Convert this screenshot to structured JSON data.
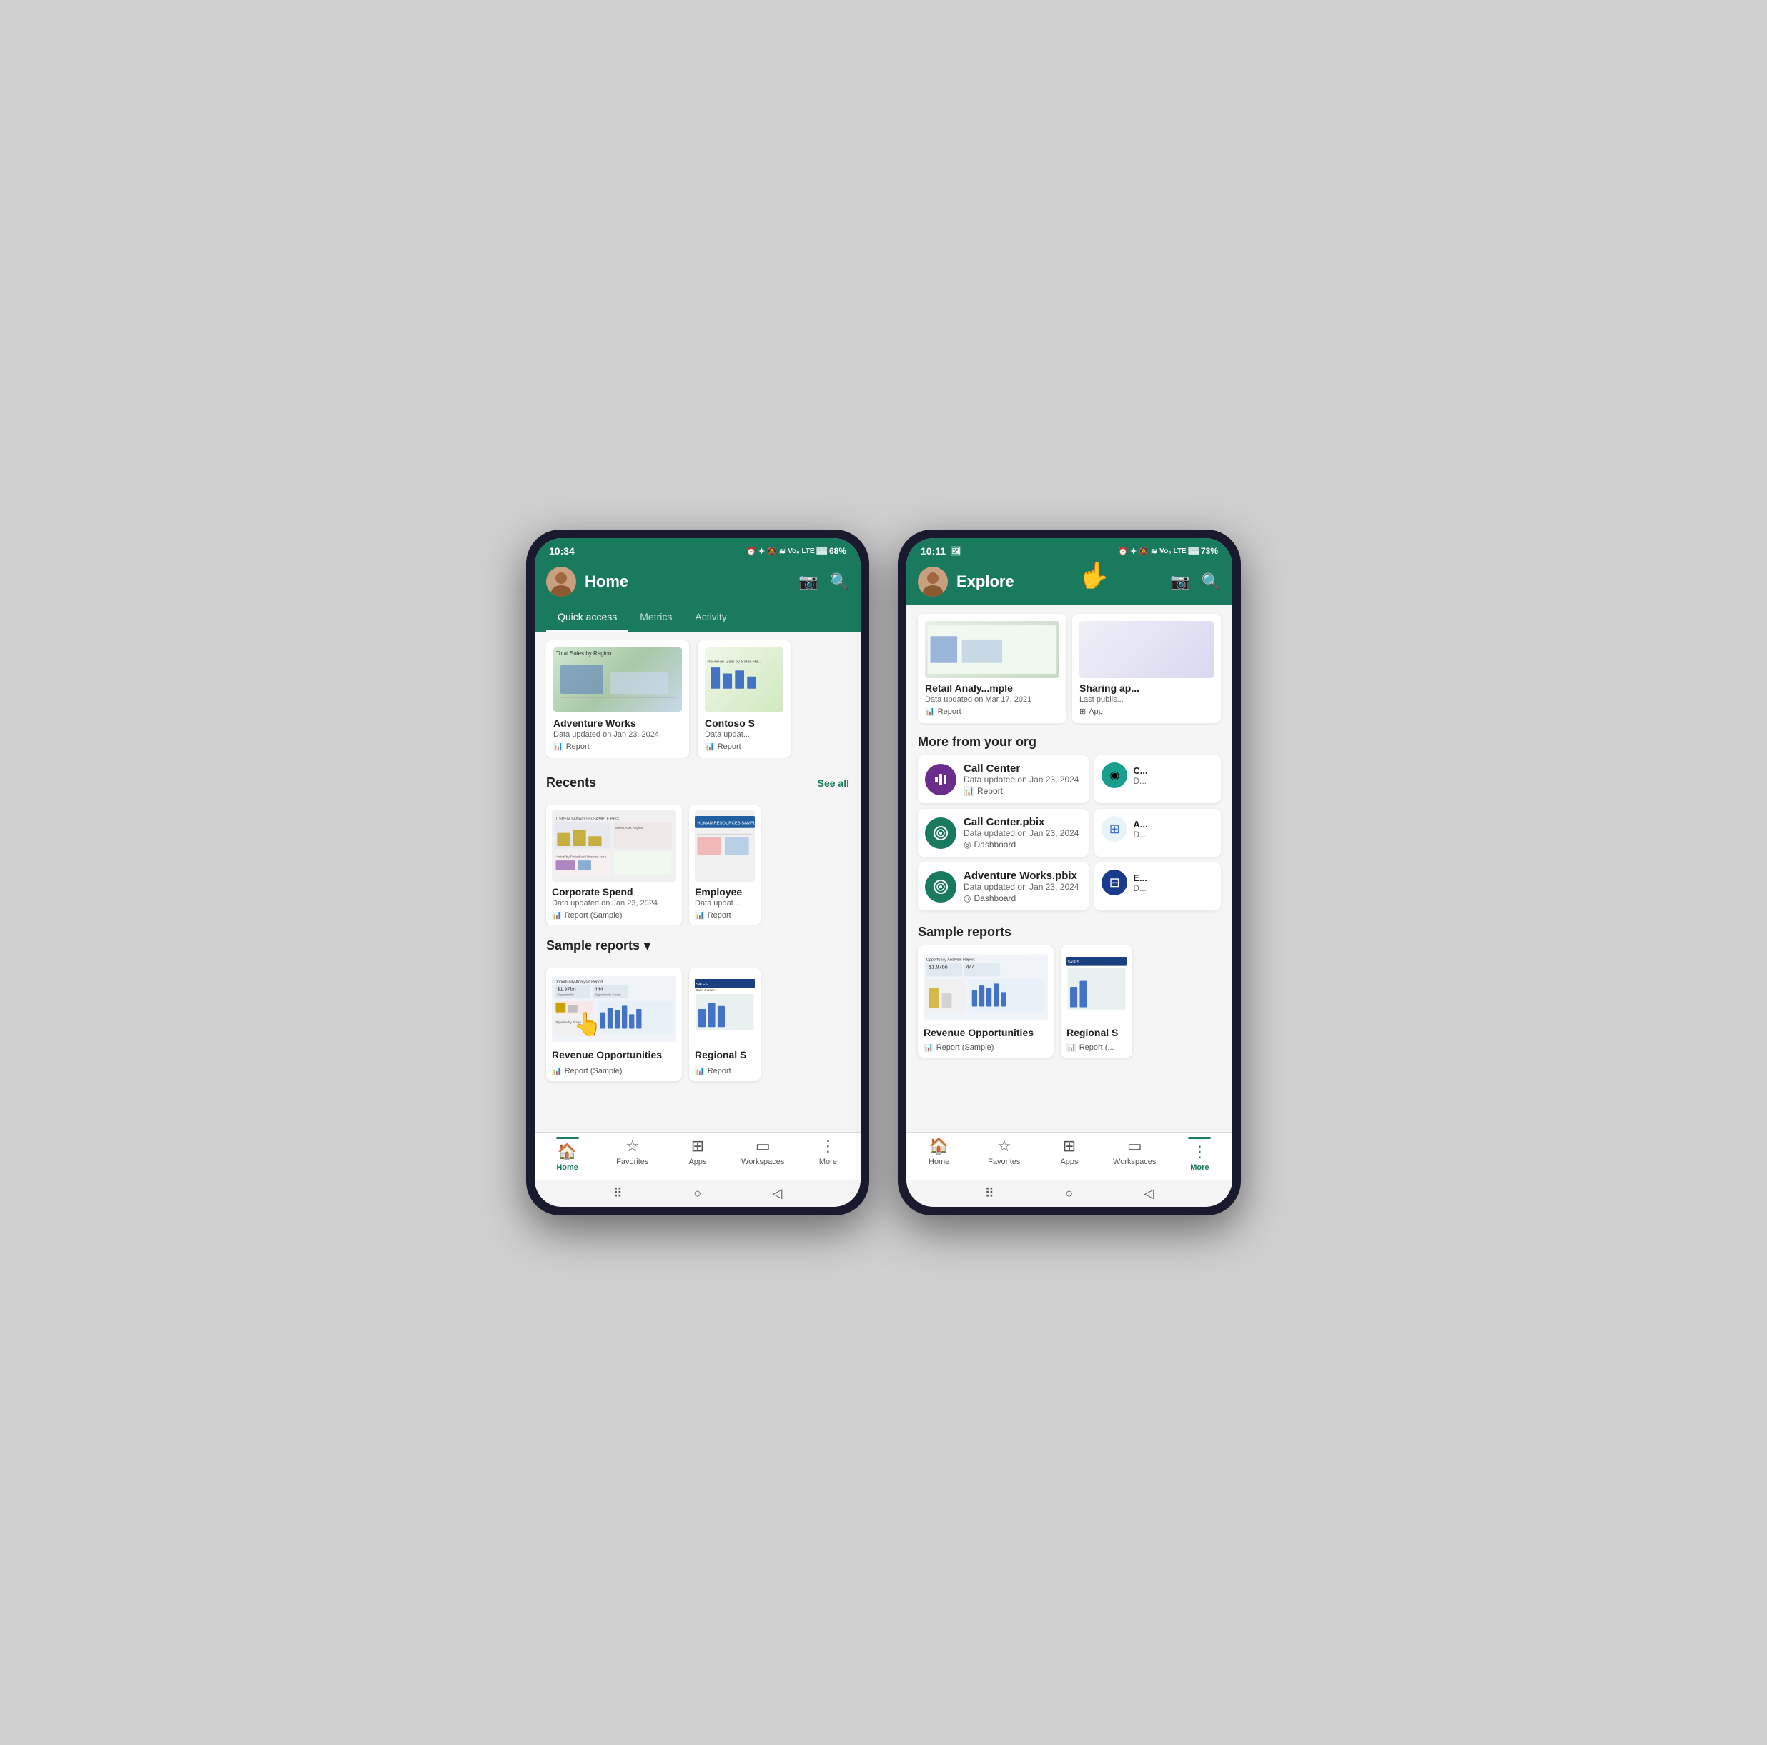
{
  "phone1": {
    "statusBar": {
      "time": "10:34",
      "battery": "68%",
      "icons": "🔔 ✦ ☊ ≋ Vo₀ LTE ▓▓"
    },
    "header": {
      "title": "Home",
      "cameraIcon": "📷",
      "searchIcon": "🔍"
    },
    "tabs": [
      {
        "label": "Quick access",
        "active": true
      },
      {
        "label": "Metrics",
        "active": false
      },
      {
        "label": "Activity",
        "active": false
      }
    ],
    "quickAccess": {
      "cards": [
        {
          "title": "Adventure Works",
          "date": "Data updated on Jan 23, 2024",
          "type": "Report"
        },
        {
          "title": "Contoso S",
          "date": "Data updat...",
          "type": "Report"
        }
      ]
    },
    "recents": {
      "sectionTitle": "Recents",
      "seeAllLabel": "See all",
      "cards": [
        {
          "title": "Corporate Spend",
          "date": "Data updated on Jan 23, 2024",
          "type": "Report (Sample)"
        },
        {
          "title": "Employee",
          "date": "Data updat...",
          "type": "Report"
        }
      ]
    },
    "sampleReports": {
      "sectionTitle": "Sample reports",
      "chevron": "▾",
      "cards": [
        {
          "title": "Revenue Opportunities",
          "date": "",
          "type": "Report (Sample)"
        },
        {
          "title": "Regional S",
          "date": "",
          "type": "Report"
        }
      ]
    },
    "bottomNav": [
      {
        "icon": "🏠",
        "label": "Home",
        "active": true
      },
      {
        "icon": "☆",
        "label": "Favorites",
        "active": false
      },
      {
        "icon": "⊞",
        "label": "Apps",
        "active": false
      },
      {
        "icon": "▭",
        "label": "Workspaces",
        "active": false
      },
      {
        "icon": "⋮",
        "label": "More",
        "active": false
      }
    ]
  },
  "phone2": {
    "statusBar": {
      "time": "10:11",
      "battery": "73%",
      "icons": "🔔 ✦ ☊ ≋ Vo₀ LTE ▓▓"
    },
    "header": {
      "title": "Explore",
      "cameraIcon": "📷",
      "searchIcon": "🔍"
    },
    "topCards": [
      {
        "title": "Retail Analy...mple",
        "date": "Data updated on Mar 17, 2021",
        "type": "Report"
      },
      {
        "title": "Sharing ap...",
        "date": "Last publis...",
        "type": "App"
      }
    ],
    "moreFromOrg": {
      "sectionTitle": "More from your org",
      "cards": [
        {
          "title": "Call Center",
          "date": "Data updated on Jan 23, 2024",
          "type": "Report",
          "iconBg": "#6b2d8b",
          "iconText": "📊"
        },
        {
          "title": "Call Center.pbix",
          "date": "Data updated on Jan 23, 2024",
          "type": "Dashboard",
          "iconBg": "#1a7a5e",
          "iconText": "◎"
        },
        {
          "title": "Adventure Works.pbix",
          "date": "Data updated on Jan 23, 2024",
          "type": "Dashboard",
          "iconBg": "#1a7a5e",
          "iconText": "◎"
        }
      ],
      "rightCards": [
        {
          "iconBg": "#1a9e8e",
          "iconText": "◉",
          "title": "C...",
          "date": "D..."
        },
        {
          "iconBg": "#e8f4f8",
          "iconText": "⊞",
          "title": "A...",
          "date": "D..."
        },
        {
          "iconBg": "#1a4a8e",
          "iconText": "⊟",
          "title": "E...",
          "date": "D..."
        }
      ]
    },
    "sampleReports": {
      "sectionTitle": "Sample reports",
      "cards": [
        {
          "title": "Revenue Opportunities",
          "type": "Report (Sample)"
        },
        {
          "title": "Regional S",
          "type": "Report (..."
        }
      ]
    },
    "bottomNav": [
      {
        "icon": "🏠",
        "label": "Home",
        "active": false
      },
      {
        "icon": "☆",
        "label": "Favorites",
        "active": false
      },
      {
        "icon": "⊞",
        "label": "Apps",
        "active": false
      },
      {
        "icon": "▭",
        "label": "Workspaces",
        "active": false
      },
      {
        "icon": "⋮",
        "label": "More",
        "active": true
      }
    ]
  }
}
